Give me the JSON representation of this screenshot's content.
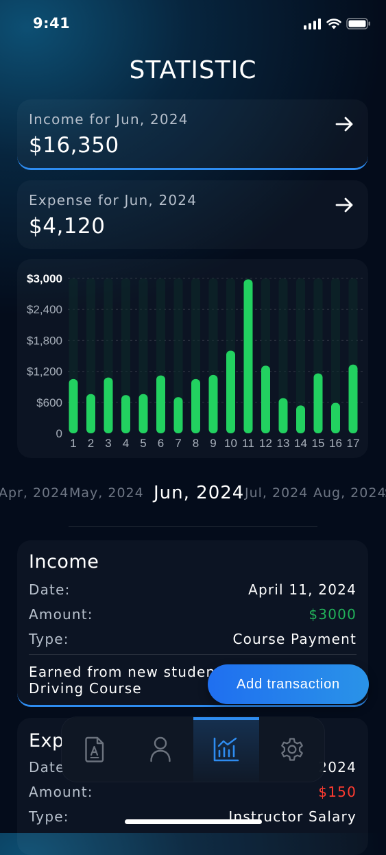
{
  "status_bar": {
    "time": "9:41"
  },
  "header": {
    "title": "STATISTIC"
  },
  "income_summary": {
    "label": "Income for Jun, 2024",
    "value": "$16,350"
  },
  "expense_summary": {
    "label": "Expense for Jun, 2024",
    "value": "$4,120"
  },
  "chart_data": {
    "type": "bar",
    "categories": [
      "1",
      "2",
      "3",
      "4",
      "5",
      "6",
      "7",
      "8",
      "9",
      "10",
      "11",
      "12",
      "13",
      "14",
      "15",
      "16",
      "17"
    ],
    "values": [
      1050,
      760,
      1080,
      740,
      760,
      1120,
      700,
      1050,
      1130,
      1600,
      2980,
      1310,
      680,
      540,
      1160,
      590,
      1330
    ],
    "ylim": [
      0,
      3000
    ],
    "yticks": [
      "0",
      "$600",
      "$1,200",
      "$1,800",
      "$2,400",
      "$3,000"
    ],
    "yticks_values": [
      0,
      600,
      1200,
      1800,
      2400,
      3000
    ],
    "grid": true,
    "colors": {
      "bar": "#22d160",
      "track": "#0d2a2a"
    }
  },
  "months": {
    "items": [
      "Apr, 2024",
      "May, 2024",
      "Jun, 2024",
      "Jul, 2024",
      "Aug, 2024",
      "S"
    ],
    "selected": "Jun, 2024"
  },
  "income_transaction": {
    "title": "Income",
    "date_label": "Date:",
    "date_value": "April 11, 2024",
    "amount_label": "Amount:",
    "amount_value": "$3000",
    "type_label": "Type:",
    "type_value": "Course Payment",
    "note_line1": "Earned from new studen",
    "note_line2": "Driving Course"
  },
  "expense_transaction": {
    "title": "Exp",
    "date_label": "Date",
    "date_value": "2024",
    "amount_label": "Amount:",
    "amount_value": "$150",
    "type_label": "Type:",
    "type_value": "Instructor Salary"
  },
  "add_transaction": {
    "label": "Add transaction"
  },
  "tabbar": {
    "items": [
      {
        "icon": "report-icon"
      },
      {
        "icon": "profile-icon"
      },
      {
        "icon": "statistics-icon",
        "active": true
      },
      {
        "icon": "settings-icon"
      }
    ]
  },
  "colors": {
    "accent": "#2e8cf0",
    "positive": "#22b35a",
    "negative": "#ff3b30",
    "bar": "#22d160"
  }
}
